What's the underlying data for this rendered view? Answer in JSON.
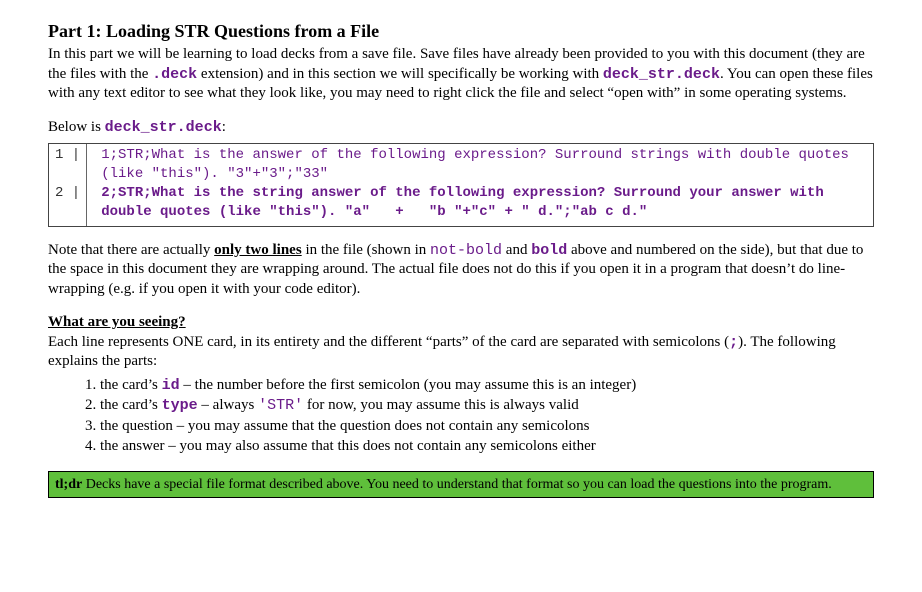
{
  "heading": "Part 1: Loading STR Questions from a File",
  "intro_parts": {
    "t1": "In this part we will be learning to load decks from a save file. Save files have already been provided to you with this document (they are the files with the ",
    "ext": ".deck",
    "t2": " extension) and in this section we will specifically be working with ",
    "file": "deck_str.deck",
    "t3": ". You can open these files with any text editor to see what they look like, you may need to right click the file and select “open with” in some operating systems."
  },
  "below_label_pre": "Below is ",
  "below_file": "deck_str.deck",
  "below_label_post": ":",
  "code": {
    "gutter1": "1 |",
    "gutter2": "2 |",
    "line1": "1;STR;What is the answer of the following expression? Surround strings with double quotes (like \"this\"). \"3\"+\"3\";\"33\"",
    "line2": "2;STR;What is the string answer of the following expression? Surround your answer with double quotes (like \"this\"). \"a\"   +   \"b \"+\"c\" + \" d.\";\"ab c d.\""
  },
  "note": {
    "n1": "Note that there are actually ",
    "only_two": "only two lines",
    "n2": " in the file (shown in ",
    "notbold": "not-bold",
    "n3": " and ",
    "bold": "bold",
    "n4": " above and numbered on the side), but that due to the space in this document they are wrapping around. The actual file does not do this if you open it in a program that doesn’t do line-wrapping (e.g. if you open it with your code editor)."
  },
  "seeing_head": "What are you seeing?",
  "seeing_para_a": "Each line represents ONE card, in its entirety and the different “parts” of the card are separated with semicolons (",
  "seeing_semi": ";",
  "seeing_para_b": "). The following explains the parts:",
  "list": {
    "i1a": "the card’s ",
    "i1kw": "id",
    "i1b": " – the number before the first semicolon (you may assume this is an integer)",
    "i2a": "the card’s ",
    "i2kw": "type",
    "i2b": " – always ",
    "i2code": "'STR'",
    "i2c": " for now, you may assume this is always valid",
    "i3": "the question – you may assume that the question does not contain any semicolons",
    "i4": "the answer – you may also assume that this does not contain any semicolons either"
  },
  "tldr": {
    "label": "tl;dr",
    "text": "   Decks have a special file format described above. You need to understand that format so you can load the questions into the program."
  }
}
